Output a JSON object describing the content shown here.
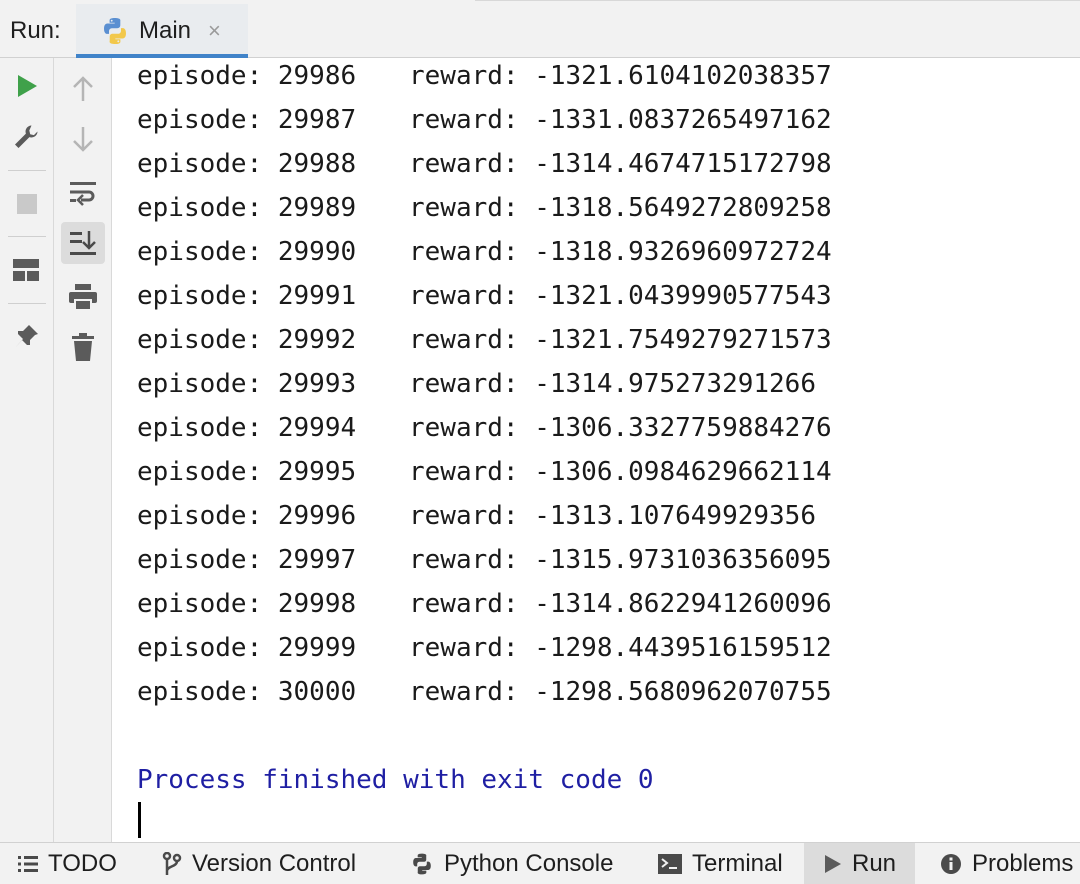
{
  "header": {
    "run_label": "Run:",
    "tab_label": "Main",
    "tab_close": "×"
  },
  "toolbar": {
    "primary": [
      "run-icon",
      "wrench-icon",
      "stop-icon",
      "layout-icon",
      "pin-icon"
    ],
    "secondary": [
      "arrow-up-icon",
      "arrow-down-icon",
      "soft-wrap-icon",
      "scroll-to-end-icon",
      "print-icon",
      "trash-icon"
    ]
  },
  "console": {
    "lines": [
      {
        "episode": "episode: 29986",
        "reward": "reward: -1321.6104102038357"
      },
      {
        "episode": "episode: 29987",
        "reward": "reward: -1331.0837265497162"
      },
      {
        "episode": "episode: 29988",
        "reward": "reward: -1314.4674715172798"
      },
      {
        "episode": "episode: 29989",
        "reward": "reward: -1318.5649272809258"
      },
      {
        "episode": "episode: 29990",
        "reward": "reward: -1318.9326960972724"
      },
      {
        "episode": "episode: 29991",
        "reward": "reward: -1321.0439990577543"
      },
      {
        "episode": "episode: 29992",
        "reward": "reward: -1321.7549279271573"
      },
      {
        "episode": "episode: 29993",
        "reward": "reward: -1314.975273291266"
      },
      {
        "episode": "episode: 29994",
        "reward": "reward: -1306.3327759884276"
      },
      {
        "episode": "episode: 29995",
        "reward": "reward: -1306.0984629662114"
      },
      {
        "episode": "episode: 29996",
        "reward": "reward: -1313.107649929356"
      },
      {
        "episode": "episode: 29997",
        "reward": "reward: -1315.9731036356095"
      },
      {
        "episode": "episode: 29998",
        "reward": "reward: -1314.8622941260096"
      },
      {
        "episode": "episode: 29999",
        "reward": "reward: -1298.4439516159512"
      },
      {
        "episode": "episode: 30000",
        "reward": "reward: -1298.5680962070755"
      }
    ],
    "finish_message": "Process finished with exit code 0"
  },
  "bottombar": {
    "todo": "TODO",
    "version_control": "Version Control",
    "python_console": "Python Console",
    "terminal": "Terminal",
    "run": "Run",
    "problems": "Problems"
  },
  "colors": {
    "accent": "#4083c9",
    "run_green": "#3fa14a",
    "finish_text": "#1f1fa3"
  }
}
